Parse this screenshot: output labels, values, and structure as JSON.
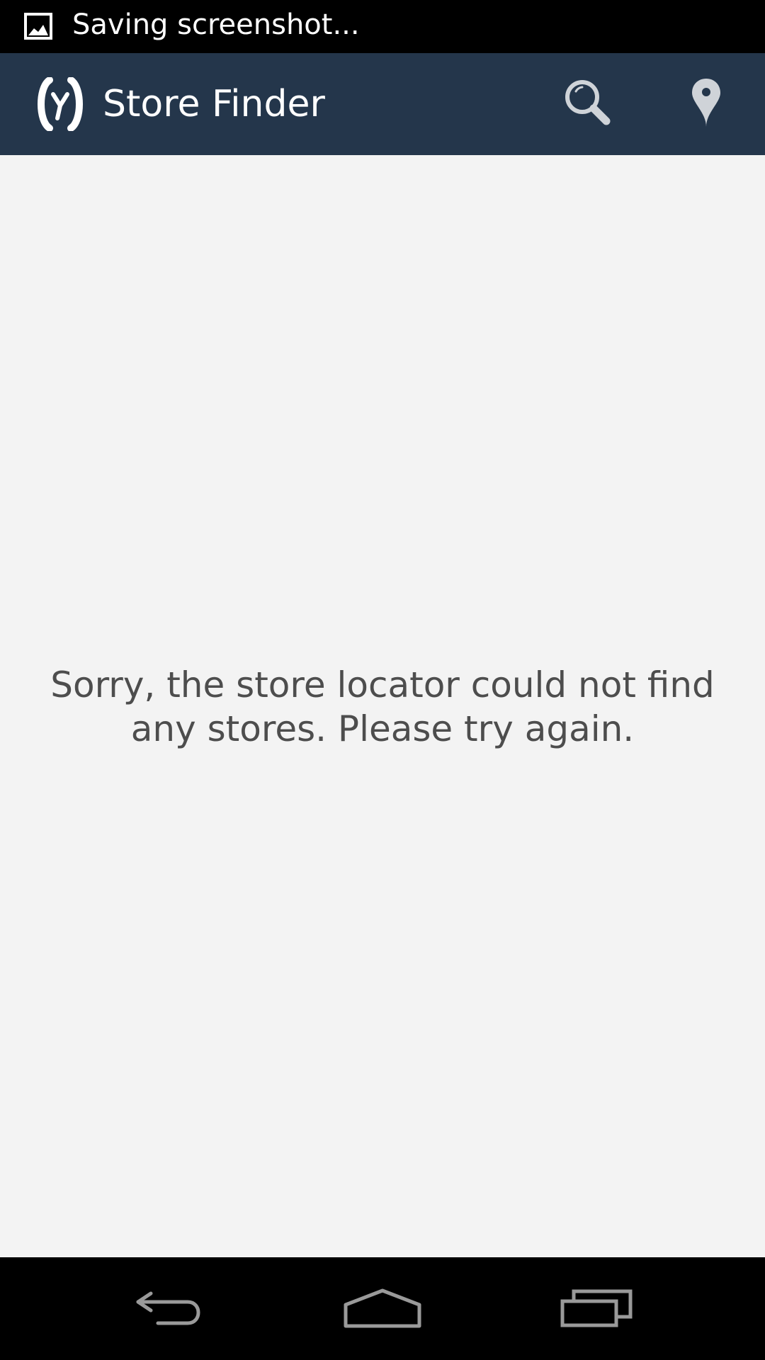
{
  "status_bar": {
    "notification_text": "Saving screenshot...",
    "notification_icon": "image-icon"
  },
  "action_bar": {
    "title": "Store Finder",
    "logo_icon": "app-logo-icon",
    "actions": [
      {
        "icon": "search-icon"
      },
      {
        "icon": "map-pin-icon"
      }
    ],
    "background_color": "#24364b"
  },
  "content": {
    "message": "Sorry, the store locator could not find any stores. Please try again.",
    "background_color": "#f3f3f3"
  },
  "nav_bar": {
    "buttons": [
      {
        "icon": "back-icon"
      },
      {
        "icon": "home-icon"
      },
      {
        "icon": "recents-icon"
      }
    ]
  }
}
